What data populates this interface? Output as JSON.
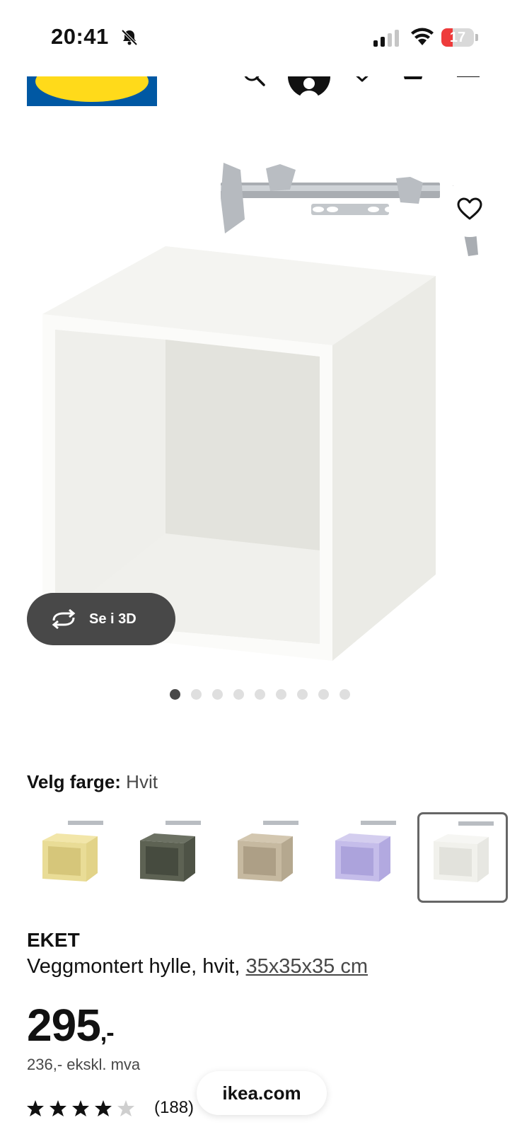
{
  "status_bar": {
    "time": "20:41",
    "battery": "17"
  },
  "product": {
    "brand_name": "EKET",
    "description": "Veggmontert hylle, hvit,",
    "size_link": "35x35x35 cm",
    "price": "295",
    "price_suffix": ",-",
    "price_excl_vat": "236,- ekskl. mva",
    "rating_count": "(188)",
    "rating_value": 4.5
  },
  "gallery": {
    "view_3d_label": "Se i 3D",
    "image_count": 9,
    "active_index": 0
  },
  "color_chooser": {
    "label": "Velg farge:",
    "selected": "Hvit",
    "options": [
      {
        "color": "#e9dc96"
      },
      {
        "color": "#5d6253"
      },
      {
        "color": "#c6b9a0"
      },
      {
        "color": "#c5bdea"
      },
      {
        "color": "#f1f1ec"
      }
    ]
  },
  "browser": {
    "url": "ikea.com"
  },
  "colors": {
    "accent_dark": "#484848",
    "ikea_blue": "#0058a3",
    "ikea_yellow": "#ffda1a"
  }
}
